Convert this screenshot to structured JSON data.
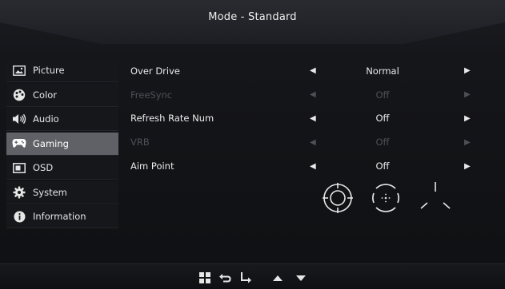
{
  "header": {
    "title": "Mode - Standard"
  },
  "sidebar": {
    "items": [
      {
        "label": "Picture",
        "icon": "picture-icon",
        "active": false
      },
      {
        "label": "Color",
        "icon": "palette-icon",
        "active": false
      },
      {
        "label": "Audio",
        "icon": "speaker-icon",
        "active": false
      },
      {
        "label": "Gaming",
        "icon": "gamepad-icon",
        "active": true
      },
      {
        "label": "OSD",
        "icon": "osd-icon",
        "active": false
      },
      {
        "label": "System",
        "icon": "gear-icon",
        "active": false
      },
      {
        "label": "Information",
        "icon": "info-icon",
        "active": false
      }
    ]
  },
  "settings": {
    "rows": [
      {
        "label": "Over Drive",
        "value": "Normal",
        "enabled": true
      },
      {
        "label": "FreeSync",
        "value": "Off",
        "enabled": false
      },
      {
        "label": "Refresh Rate Num",
        "value": "Off",
        "enabled": true
      },
      {
        "label": "VRB",
        "value": "Off",
        "enabled": false
      },
      {
        "label": "Aim Point",
        "value": "Off",
        "enabled": true
      }
    ],
    "arrow_left": "◀",
    "arrow_right": "▶"
  },
  "aim_point_options": [
    "crosshair-ring-icon",
    "crosshair-dot-icon",
    "crosshair-tri-icon"
  ],
  "footer": {
    "buttons": [
      "menu-grid-icon",
      "return-icon",
      "enter-icon",
      "up-arrow-icon",
      "down-arrow-icon"
    ]
  },
  "colors": {
    "active_highlight": "#5f6166",
    "disabled_text": "#4e5057",
    "text": "#e9e9e9"
  }
}
